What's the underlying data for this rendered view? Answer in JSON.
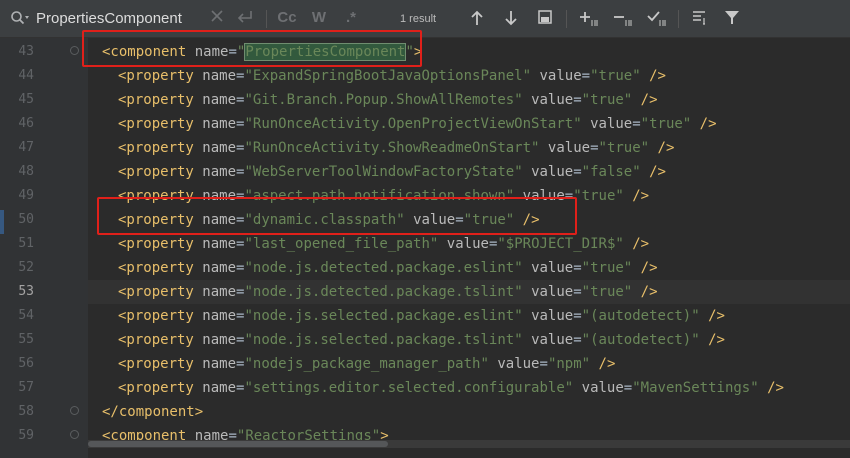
{
  "search": {
    "value": "PropertiesComponent",
    "result_count": "1 result",
    "case_label": "Cc",
    "words_label": "W",
    "regex_label": ".*"
  },
  "colors": {
    "highlight_box": "#e0201a",
    "tag": "#e8bf6a",
    "string": "#6a8759"
  },
  "lines": [
    {
      "num": "43",
      "depth": 0,
      "tag": "<component",
      "name": "PropertiesComponent",
      "value": null,
      "close": ">"
    },
    {
      "num": "44",
      "depth": 1,
      "tag": "<property",
      "name": "ExpandSpringBootJavaOptionsPanel",
      "value": "true",
      "close": "/>"
    },
    {
      "num": "45",
      "depth": 1,
      "tag": "<property",
      "name": "Git.Branch.Popup.ShowAllRemotes",
      "value": "true",
      "close": "/>"
    },
    {
      "num": "46",
      "depth": 1,
      "tag": "<property",
      "name": "RunOnceActivity.OpenProjectViewOnStart",
      "value": "true",
      "close": "/>"
    },
    {
      "num": "47",
      "depth": 1,
      "tag": "<property",
      "name": "RunOnceActivity.ShowReadmeOnStart",
      "value": "true",
      "close": "/>"
    },
    {
      "num": "48",
      "depth": 1,
      "tag": "<property",
      "name": "WebServerToolWindowFactoryState",
      "value": "false",
      "close": "/>"
    },
    {
      "num": "49",
      "depth": 1,
      "tag": "<property",
      "name": "aspect.path.notification.shown",
      "value": "true",
      "close": "/>"
    },
    {
      "num": "50",
      "depth": 1,
      "tag": "<property",
      "name": "dynamic.classpath",
      "value": "true",
      "close": "/>"
    },
    {
      "num": "51",
      "depth": 1,
      "tag": "<property",
      "name": "last_opened_file_path",
      "value": "$PROJECT_DIR$",
      "close": "/>"
    },
    {
      "num": "52",
      "depth": 1,
      "tag": "<property",
      "name": "node.js.detected.package.eslint",
      "value": "true",
      "close": "/>"
    },
    {
      "num": "53",
      "depth": 1,
      "tag": "<property",
      "name": "node.js.detected.package.tslint",
      "value": "true",
      "close": "/>"
    },
    {
      "num": "54",
      "depth": 1,
      "tag": "<property",
      "name": "node.js.selected.package.eslint",
      "value": "(autodetect)",
      "close": "/>"
    },
    {
      "num": "55",
      "depth": 1,
      "tag": "<property",
      "name": "node.js.selected.package.tslint",
      "value": "(autodetect)",
      "close": "/>"
    },
    {
      "num": "56",
      "depth": 1,
      "tag": "<property",
      "name": "nodejs_package_manager_path",
      "value": "npm",
      "close": "/>"
    },
    {
      "num": "57",
      "depth": 1,
      "tag": "<property",
      "name": "settings.editor.selected.configurable",
      "value": "MavenSettings",
      "close": "/>"
    },
    {
      "num": "58",
      "depth": 0,
      "tag": "</component",
      "name": null,
      "value": null,
      "close": ">"
    },
    {
      "num": "59",
      "depth": 0,
      "tag": "<component",
      "name": "ReactorSettings",
      "value": null,
      "close": ">"
    }
  ],
  "current_line": "53"
}
